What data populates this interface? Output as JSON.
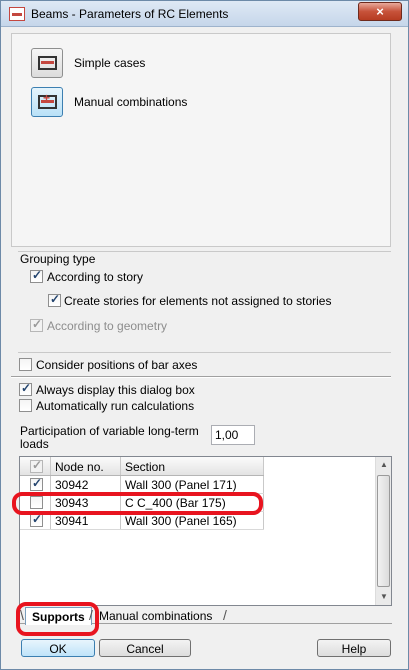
{
  "window": {
    "title": "Beams - Parameters of RC Elements",
    "close_glyph": "×"
  },
  "toolbar": {
    "simple_cases": "Simple cases",
    "manual_combinations": "Manual combinations"
  },
  "grouping": {
    "title": "Grouping type",
    "according_story": "According to story",
    "create_stories": "Create stories for elements not assigned to stories",
    "according_geometry": "According to geometry"
  },
  "options": {
    "bar_axes": "Consider positions of bar axes",
    "always_display": "Always display this dialog box",
    "auto_run": "Automatically run calculations"
  },
  "param": {
    "label": "Participation of variable long-term loads",
    "value": "1,00"
  },
  "table": {
    "columns": [
      "Node no.",
      "Section"
    ],
    "rows": [
      {
        "node": "30942",
        "section": "Wall 300 (Panel 171)",
        "checked": true
      },
      {
        "node": "30943",
        "section": "C C_400 (Bar 175)",
        "checked": false
      },
      {
        "node": "30941",
        "section": "Wall 300 (Panel 165)",
        "checked": true
      }
    ]
  },
  "tabs": {
    "supports": "Supports",
    "manual": "Manual combinations"
  },
  "buttons": {
    "ok": "OK",
    "cancel": "Cancel",
    "help": "Help"
  }
}
